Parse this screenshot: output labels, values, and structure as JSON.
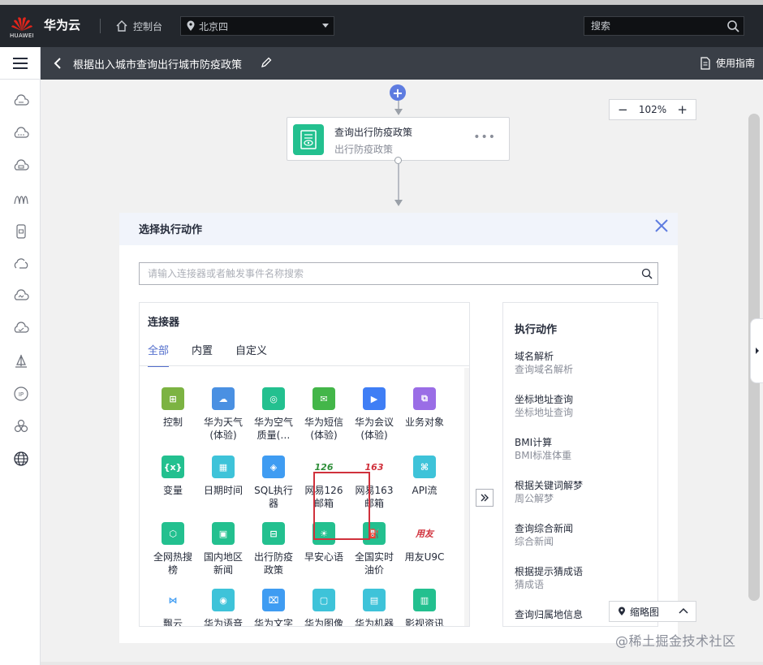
{
  "topbar": {
    "logo_text": "HUAWEI",
    "brand": "华为云",
    "console": "控制台",
    "region": "北京四",
    "search_placeholder": "搜索"
  },
  "page": {
    "title": "根据出入城市查询出行城市防疫政策",
    "guide": "使用指南"
  },
  "zoom": {
    "level": "102%",
    "minus": "−",
    "plus": "+"
  },
  "node": {
    "title": "查询出行防疫政策",
    "subtitle": "出行防疫政策",
    "more": "•••"
  },
  "dialog": {
    "title": "选择执行动作",
    "search_placeholder": "请输入连接器或者触发事件名称搜索"
  },
  "connectors": {
    "title": "连接器",
    "tabs": [
      "全部",
      "内置",
      "自定义"
    ],
    "items": [
      {
        "label": "控制",
        "color": "#7cb342",
        "glyph": "⊞"
      },
      {
        "label": "华为天气\n(体验)",
        "color": "#4a90e2",
        "glyph": "☁"
      },
      {
        "label": "华为空气\n质量(…",
        "color": "#23c08f",
        "glyph": "◎"
      },
      {
        "label": "华为短信\n(体验)",
        "color": "#43b649",
        "glyph": "✉"
      },
      {
        "label": "华为会议\n(体验)",
        "color": "#3f7ef5",
        "glyph": "▶"
      },
      {
        "label": "业务对象",
        "color": "#9a6de6",
        "glyph": "⧉"
      },
      {
        "label": "变量",
        "color": "#23c08f",
        "glyph": "{x}"
      },
      {
        "label": "日期时间",
        "color": "#3ec3d9",
        "glyph": "▦"
      },
      {
        "label": "SQL执行\n器",
        "color": "#3f9cf2",
        "glyph": "◈"
      },
      {
        "label": "网易126\n邮箱",
        "color": "#ffffff",
        "glyph": "126",
        "fg": "#2f8f3a"
      },
      {
        "label": "网易163\n邮箱",
        "color": "#ffffff",
        "glyph": "163",
        "fg": "#d0313c"
      },
      {
        "label": "API流",
        "color": "#3ec3d9",
        "glyph": "⌘"
      },
      {
        "label": "全网热搜\n榜",
        "color": "#23c08f",
        "glyph": "⬡"
      },
      {
        "label": "国内地区\n新闻",
        "color": "#23c08f",
        "glyph": "▣"
      },
      {
        "label": "出行防疫\n政策",
        "color": "#23c08f",
        "glyph": "⊟"
      },
      {
        "label": "早安心语",
        "color": "#23c08f",
        "glyph": "☀"
      },
      {
        "label": "全国实时\n油价",
        "color": "#23c08f",
        "glyph": "⛽"
      },
      {
        "label": "用友U9C",
        "color": "#ffffff",
        "glyph": "用友",
        "fg": "#d0313c"
      },
      {
        "label": "飘云",
        "color": "#ffffff",
        "glyph": "⋈",
        "fg": "#3f9cf2"
      },
      {
        "label": "华为语音",
        "color": "#3ec3d9",
        "glyph": "◉"
      },
      {
        "label": "华为文字",
        "color": "#3f9cf2",
        "glyph": "⌧"
      },
      {
        "label": "华为图像",
        "color": "#3ec3d9",
        "glyph": "▢"
      },
      {
        "label": "华为机器",
        "color": "#3ec3d9",
        "glyph": "▤"
      },
      {
        "label": "影视资讯",
        "color": "#23c08f",
        "glyph": "▥"
      }
    ]
  },
  "actions": {
    "title": "执行动作",
    "items": [
      {
        "name": "域名解析",
        "desc": "查询域名解析"
      },
      {
        "name": "坐标地址查询",
        "desc": "坐标地址查询"
      },
      {
        "name": "BMI计算",
        "desc": "BMI标准体重"
      },
      {
        "name": "根据关键词解梦",
        "desc": "周公解梦"
      },
      {
        "name": "查询综合新闻",
        "desc": "综合新闻"
      },
      {
        "name": "根据提示猜成语",
        "desc": "猜成语"
      },
      {
        "name": "查询归属地信息",
        "desc": ""
      }
    ]
  },
  "minimap": {
    "label": "缩略图"
  },
  "watermark": "@稀土掘金技术社区"
}
